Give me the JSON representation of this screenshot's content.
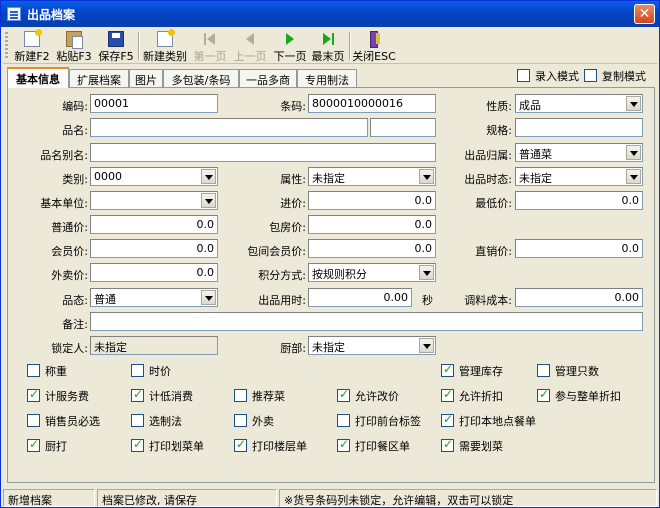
{
  "window": {
    "title": "出品档案"
  },
  "toolbar": {
    "new": "新建F2",
    "paste": "粘贴F3",
    "save": "保存F5",
    "new_category": "新建类别",
    "first": "第一页",
    "prev": "上一页",
    "next": "下一页",
    "last": "最末页",
    "close": "关闭ESC"
  },
  "tabs": [
    "基本信息",
    "扩展档案",
    "图片",
    "多包装/条码",
    "一品多商",
    "专用制法"
  ],
  "mode": {
    "entry": "录入模式",
    "copy": "复制模式"
  },
  "form": {
    "code": {
      "label": "编码:",
      "value": "00001"
    },
    "barcode": {
      "label": "条码:",
      "value": "8000010000016"
    },
    "nature": {
      "label": "性质:",
      "value": "成品"
    },
    "name": {
      "label": "品名:",
      "value": ""
    },
    "spec": {
      "label": "规格:",
      "value": ""
    },
    "alias": {
      "label": "品名别名:",
      "value": ""
    },
    "belong": {
      "label": "出品归属:",
      "value": "普通菜"
    },
    "category": {
      "label": "类别:",
      "value": "0000"
    },
    "attribute": {
      "label": "属性:",
      "value": "未指定"
    },
    "timestate": {
      "label": "出品时态:",
      "value": "未指定"
    },
    "unit": {
      "label": "基本单位:",
      "value": ""
    },
    "purchase": {
      "label": "进价:",
      "value": "0.0"
    },
    "minprice": {
      "label": "最低价:",
      "value": "0.0"
    },
    "normalprice": {
      "label": "普通价:",
      "value": "0.0"
    },
    "roomprice": {
      "label": "包房价:",
      "value": "0.0"
    },
    "memberprice": {
      "label": "会员价:",
      "value": "0.0"
    },
    "roommember": {
      "label": "包间会员价:",
      "value": "0.0"
    },
    "direct": {
      "label": "直销价:",
      "value": "0.0"
    },
    "takeout": {
      "label": "外卖价:",
      "value": "0.0"
    },
    "points": {
      "label": "积分方式:",
      "value": "按规则积分"
    },
    "state": {
      "label": "品态:",
      "value": "普通"
    },
    "usetime": {
      "label": "出品用时:",
      "value": "0.00",
      "unit": "秒"
    },
    "cost": {
      "label": "调料成本:",
      "value": "0.00"
    },
    "remark": {
      "label": "备注:",
      "value": ""
    },
    "locker": {
      "label": "锁定人:",
      "value": "未指定"
    },
    "kitchen": {
      "label": "厨部:",
      "value": "未指定"
    }
  },
  "checks": [
    {
      "label": "称重",
      "on": false
    },
    {
      "label": "时价",
      "on": false
    },
    {
      "label": "管理库存",
      "on": true
    },
    {
      "label": "管理只数",
      "on": false
    },
    {
      "label": "计服务费",
      "on": true
    },
    {
      "label": "计低消费",
      "on": true
    },
    {
      "label": "推荐菜",
      "on": false
    },
    {
      "label": "允许改价",
      "on": true
    },
    {
      "label": "允许折扣",
      "on": true
    },
    {
      "label": "参与整单折扣",
      "on": true
    },
    {
      "label": "销售员必选",
      "on": false
    },
    {
      "label": "选制法",
      "on": false
    },
    {
      "label": "外卖",
      "on": false
    },
    {
      "label": "打印前台标签",
      "on": false
    },
    {
      "label": "打印本地点餐单",
      "on": true
    },
    {
      "label": "厨打",
      "on": true
    },
    {
      "label": "打印划菜单",
      "on": true
    },
    {
      "label": "打印楼层单",
      "on": true
    },
    {
      "label": "打印餐区单",
      "on": true
    },
    {
      "label": "需要划菜",
      "on": true
    }
  ],
  "status": {
    "left": "新增档案",
    "middle": "档案已修改, 请保存",
    "right": "※货号条码列未锁定，允许编辑，双击可以锁定"
  }
}
